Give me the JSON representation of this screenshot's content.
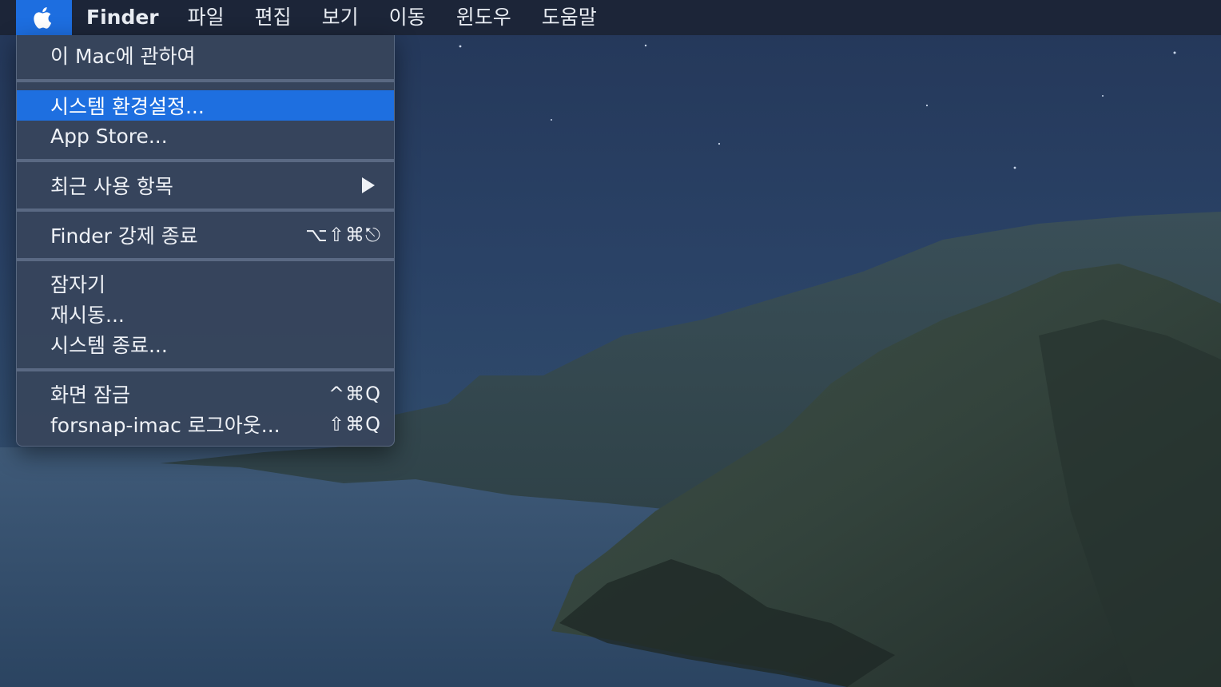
{
  "menubar": {
    "apple_icon": "apple-logo-icon",
    "app_name": "Finder",
    "menus": [
      "파일",
      "편집",
      "보기",
      "이동",
      "윈도우",
      "도움말"
    ]
  },
  "apple_menu": {
    "about": "이 Mac에 관하여",
    "system_prefs": "시스템 환경설정...",
    "app_store": "App Store...",
    "recent_items": "최근 사용 항목",
    "force_quit": "Finder 강제 종료",
    "force_quit_shortcut": "⌥⇧⌘⎋",
    "sleep": "잠자기",
    "restart": "재시동...",
    "shutdown": "시스템 종료...",
    "lock_screen": "화면 잠금",
    "lock_screen_shortcut": "^⌘Q",
    "logout": "forsnap-imac 로그아웃...",
    "logout_shortcut": "⇧⌘Q"
  },
  "colors": {
    "highlight": "#1e6fe0",
    "menubar_bg": "#1c2538",
    "menu_bg": "#37455c"
  }
}
